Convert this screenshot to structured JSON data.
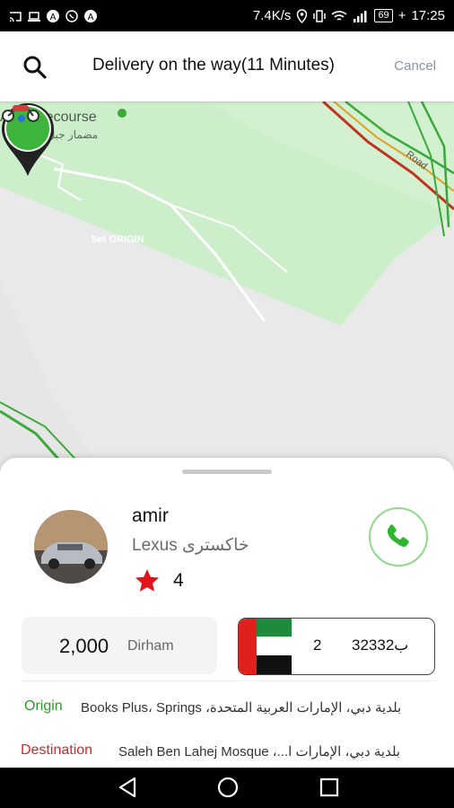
{
  "status_bar": {
    "network_speed": "7.4K/s",
    "battery": "69",
    "time": "17:25",
    "signal": "3G"
  },
  "header": {
    "title": "Delivery on the way(11 Minutes)",
    "cancel_label": "Cancel"
  },
  "map": {
    "place_label": "Ali Racecourse",
    "place_label_ar": "مضمار جبل علي",
    "pin_text": "Set ORIGIN",
    "road_label": "Road"
  },
  "driver": {
    "name": "amir",
    "car_model": "Lexus",
    "car_color": "خاكستری",
    "rating": "4"
  },
  "fare": {
    "amount": "2,000",
    "currency": "Dirham"
  },
  "plate": {
    "number": "2",
    "code": "323ب32"
  },
  "addresses": {
    "origin_label": "Origin",
    "origin_text": "بلدية دبي، الإمارات العربية المتحدة، Books Plus، Springs",
    "destination_label": "Destination",
    "destination_text": "بلدية دبي، الإمارات ا...، Saleh Ben Lahej Mosque"
  },
  "colors": {
    "accent_green": "#2a9a2a",
    "destination_red": "#e02424",
    "pin_green": "#3db53d"
  }
}
